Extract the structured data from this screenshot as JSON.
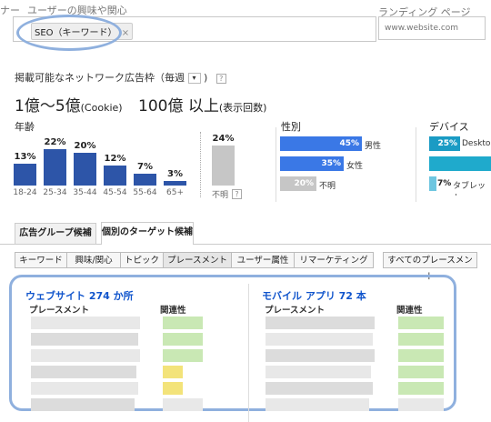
{
  "targeting": {
    "prefix_text": "ナー",
    "interest_label": "ユーザーの興味や関心",
    "keyword_chip": "SEO（キーワード）",
    "chip_remove": "×",
    "landing_label": "ランディング ページ",
    "landing_placeholder": "www.website.com"
  },
  "reach": {
    "header": "掲載可能なネットワーク広告枠（毎週",
    "help": "?",
    "cookie_value": "1億〜5億",
    "cookie_unit": "(Cookie)",
    "impression_value": "100億 以上",
    "impression_unit": "(表示回数)"
  },
  "age": {
    "title": "年齢",
    "bars": [
      {
        "label": "18-24",
        "pct_label": "13%",
        "value": 13
      },
      {
        "label": "25-34",
        "pct_label": "22%",
        "value": 22
      },
      {
        "label": "35-44",
        "pct_label": "20%",
        "value": 20
      },
      {
        "label": "45-54",
        "pct_label": "12%",
        "value": 12
      },
      {
        "label": "55-64",
        "pct_label": "7%",
        "value": 7
      },
      {
        "label": "65+",
        "pct_label": "3%",
        "value": 3
      }
    ],
    "unknown": {
      "label": "不明",
      "pct_label": "24%",
      "value": 24
    }
  },
  "gender": {
    "title": "性別",
    "rows": [
      {
        "pct_label": "45%",
        "label": "男性",
        "value": 45
      },
      {
        "pct_label": "35%",
        "label": "女性",
        "value": 35
      },
      {
        "pct_label": "20%",
        "label": "不明",
        "value": 20
      }
    ]
  },
  "device": {
    "title": "デバイス",
    "rows": [
      {
        "pct_label": "25%",
        "label": "Desktop",
        "value": 25
      },
      {
        "pct_label": "",
        "label": "",
        "value": 100
      },
      {
        "pct_label": "7%",
        "label": "タブレット",
        "value": 7
      }
    ]
  },
  "tabs": {
    "ad_group": "広告グループ候補",
    "individual": "個別のターゲット候補"
  },
  "subtabs": [
    "キーワード",
    "興味/関心",
    "トピック",
    "プレースメント",
    "ユーザー属性",
    "リマーケティング"
  ],
  "all_placements": "すべてのプレースメント",
  "results": {
    "websites_title": "ウェブサイト 274 か所",
    "mobile_title": "モバイル アプリ 72 本",
    "col_placement": "プレースメント",
    "col_relevance": "関連性"
  },
  "colors": {
    "age_bar": "#2d55a8",
    "gender_bar": "#3a78e6",
    "device_bar": "#1a9bc4",
    "highlight": "#8fb0de",
    "link": "#1155cc"
  }
}
